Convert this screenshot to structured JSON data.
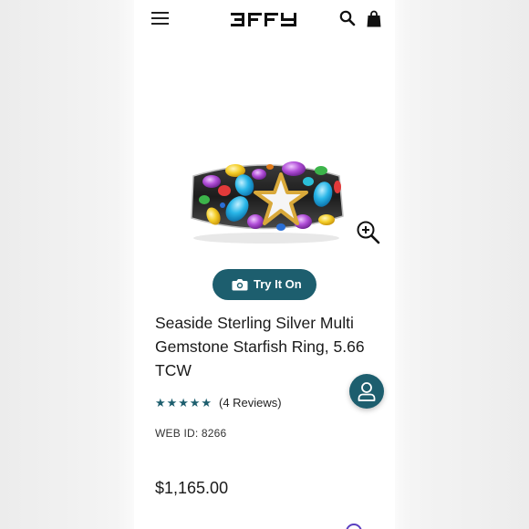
{
  "header": {
    "menu_icon": "hamburger-menu-icon",
    "logo_text": "EFFY",
    "search_icon": "search-icon",
    "bag_icon": "shopping-bag-icon"
  },
  "product": {
    "image_icon": "ring-image",
    "zoom_icon": "zoom-in-icon",
    "try_on": {
      "label": "Try It On",
      "icon": "camera-icon"
    },
    "title": "Seaside Sterling Silver Multi Gemstone Starfish Ring, 5.66 TCW",
    "rating": {
      "stars": 5,
      "star_glyph": "★",
      "reviews_text": "(4 Reviews)"
    },
    "web_id": "WEB ID: 8266",
    "price": "$1,165.00"
  },
  "chat": {
    "icon": "user-icon"
  },
  "colors": {
    "accent": "#1d5e6e",
    "text": "#1a1a1a",
    "background": "#ffffff"
  }
}
